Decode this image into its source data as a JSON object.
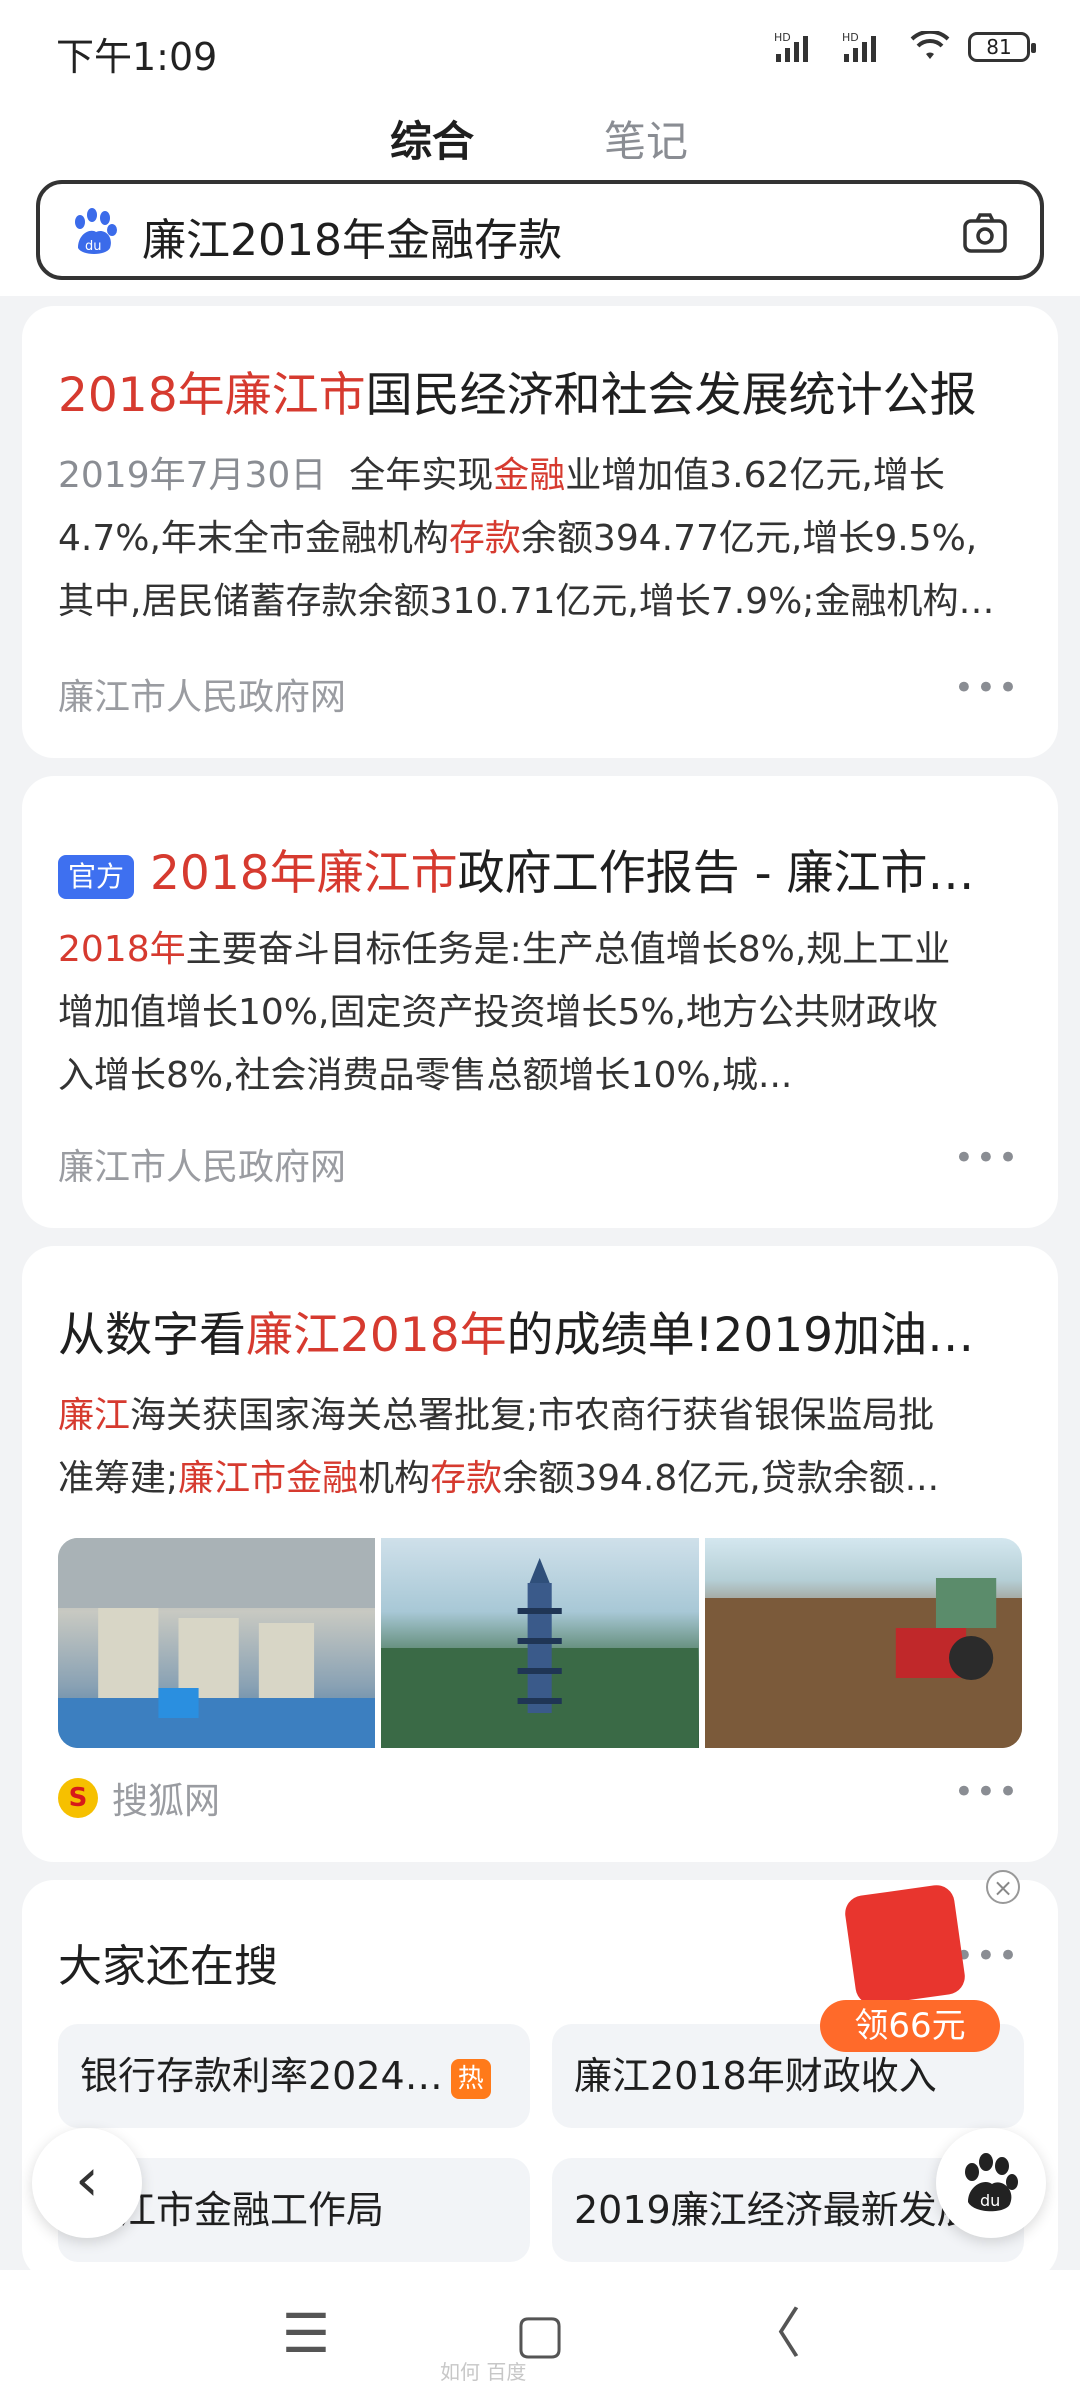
{
  "status_bar": {
    "time": "下午1:09",
    "signal1": "HD",
    "signal2": "HD",
    "battery": "81"
  },
  "tabs": [
    {
      "label": "综合"
    },
    {
      "label": "笔记"
    }
  ],
  "search": {
    "query": "廉江2018年金融存款"
  },
  "results": [
    {
      "title_highlight": "2018年廉江市",
      "title_rest": "国民经济和社会发展统计公报",
      "date": "2019年7月30日",
      "snippet_line1_a": "全年实现",
      "snippet_line1_hl": "金融",
      "snippet_line1_b": "业增加值3.62亿元,增长",
      "snippet_line2_a": "4.7%,年末全市金融机构",
      "snippet_line2_hl": "存款",
      "snippet_line2_b": "余额394.77亿元,增长9.5%,",
      "snippet_line3": "其中,居民储蓄存款余额310.71亿元,增长7.9%;金融机构…",
      "source": "廉江市人民政府网",
      "more": "•••"
    },
    {
      "badge": "官方",
      "title_highlight": "2018年廉江市",
      "title_rest": "政府工作报告 - 廉江市…",
      "snippet_hl": "2018年",
      "snippet_line1": "主要奋斗目标任务是:生产总值增长8%,规上工业",
      "snippet_line2": "增加值增长10%,固定资产投资增长5%,地方公共财政收",
      "snippet_line3": "入增长8%,社会消费品零售总额增长10%,城...",
      "source": "廉江市人民政府网",
      "more": "•••"
    },
    {
      "title_a": "从数字看",
      "title_highlight": "廉江2018年",
      "title_b": "的成绩单!2019加油…",
      "snippet_line1_hl": "廉江",
      "snippet_line1": "海关获国家海关总署批复;市农商行获省银保监局批",
      "snippet_line2_a": "准筹建;",
      "snippet_line2_hl1": "廉江市金融",
      "snippet_line2_b": "机构",
      "snippet_line2_hl2": "存款",
      "snippet_line2_c": "余额394.8亿元,贷款余额...",
      "source_icon": "S",
      "source": "搜狐网",
      "more": "•••"
    }
  ],
  "related": {
    "title": "大家还在搜",
    "more": "•••",
    "items": [
      {
        "label": "银行存款利率2024…",
        "hot": "热"
      },
      {
        "label": "廉江2018年财政收入"
      },
      {
        "label": "廉江市金融工作局"
      },
      {
        "label": "2019廉江经济最新发展"
      }
    ]
  },
  "promo": {
    "label": "领66元",
    "close": "×"
  },
  "nav": {
    "menu": "☰",
    "home": "▢",
    "back": "〈"
  },
  "watermark": "如何 百度"
}
